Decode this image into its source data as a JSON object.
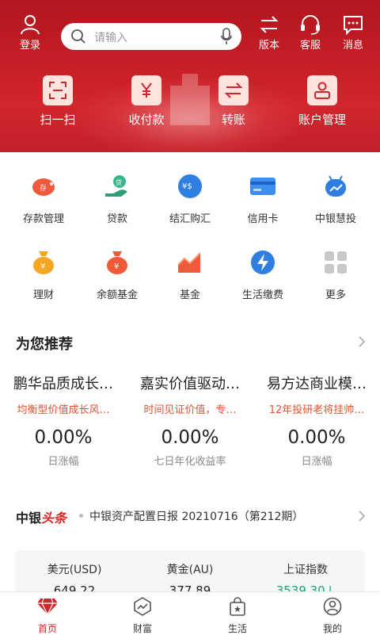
{
  "header": {
    "login_label": "登录",
    "search_placeholder": "请输入",
    "version_label": "版本",
    "service_label": "客服",
    "message_label": "消息",
    "quick_actions": [
      {
        "label": "扫一扫",
        "icon": "scan-icon"
      },
      {
        "label": "收付款",
        "icon": "yuan-icon"
      },
      {
        "label": "转账",
        "icon": "transfer-icon"
      },
      {
        "label": "账户管理",
        "icon": "account-icon"
      }
    ]
  },
  "grid": [
    {
      "label": "存款管理",
      "icon": "piggy-bank-icon"
    },
    {
      "label": "贷款",
      "icon": "loan-icon"
    },
    {
      "label": "结汇购汇",
      "icon": "currency-exchange-icon"
    },
    {
      "label": "信用卡",
      "icon": "credit-card-icon"
    },
    {
      "label": "中银慧投",
      "icon": "robot-advisor-icon"
    },
    {
      "label": "理财",
      "icon": "wealth-bag-icon"
    },
    {
      "label": "余额基金",
      "icon": "balance-fund-icon"
    },
    {
      "label": "基金",
      "icon": "fund-chart-icon"
    },
    {
      "label": "生活缴费",
      "icon": "bill-payment-icon"
    },
    {
      "label": "更多",
      "icon": "more-grid-icon"
    }
  ],
  "recommend": {
    "title": "为您推荐",
    "items": [
      {
        "name": "鹏华品质成长…",
        "desc": "均衡型价值成长风…",
        "value": "0.00%",
        "metric": "日涨幅"
      },
      {
        "name": "嘉实价值驱动…",
        "desc": "时间见证价值，专…",
        "value": "0.00%",
        "metric": "七日年化收益率"
      },
      {
        "name": "易方达商业模…",
        "desc": "12年投研老将挂帅…",
        "value": "0.00%",
        "metric": "日涨幅"
      }
    ]
  },
  "headline": {
    "logo_main": "中银",
    "logo_accent": "头条",
    "text": "中银资产配置日报 20210716（第212期）"
  },
  "market": [
    {
      "name": "美元(USD)",
      "value": "649.22"
    },
    {
      "name": "黄金(AU)",
      "value": "377.89"
    },
    {
      "name": "上证指数",
      "value": "3539.30↓"
    }
  ],
  "tabs": [
    {
      "label": "首页",
      "icon": "diamond-icon",
      "active": true
    },
    {
      "label": "财富",
      "icon": "wealth-trend-icon",
      "active": false
    },
    {
      "label": "生活",
      "icon": "shopping-bag-icon",
      "active": false
    },
    {
      "label": "我的",
      "icon": "user-icon",
      "active": false
    }
  ],
  "colors": {
    "brand_red": "#d0262c",
    "accent_orange": "#e4522f",
    "market_down": "#1ba76b"
  }
}
